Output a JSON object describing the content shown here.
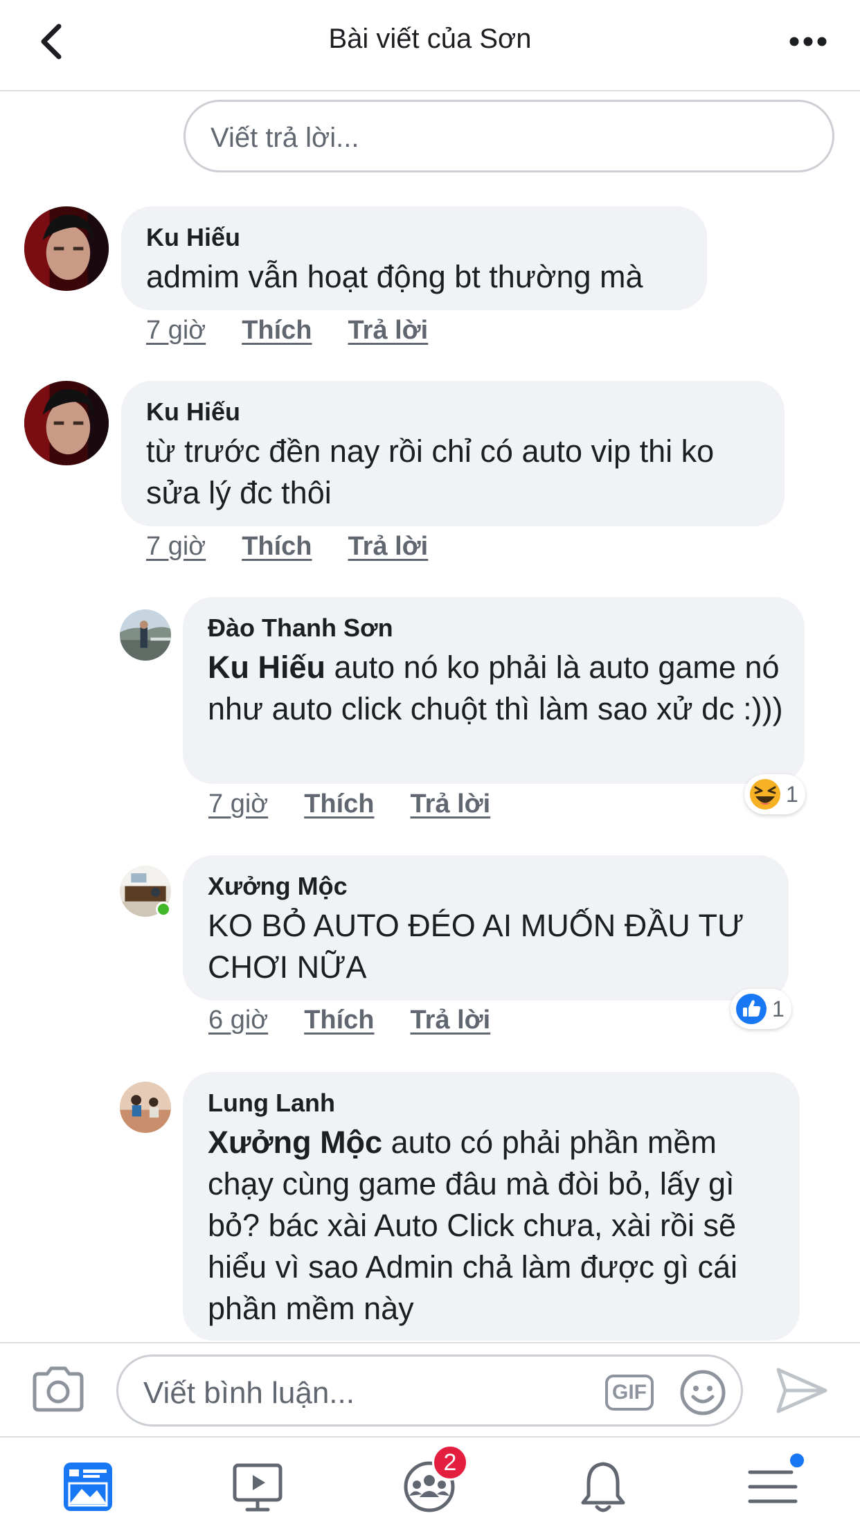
{
  "header": {
    "title": "Bài viết của Sơn"
  },
  "reply_box": {
    "placeholder": "Viết trả lời..."
  },
  "comments": [
    {
      "author": "Ku Hiếu",
      "text": "admim vẫn hoạt động bt thường mà",
      "time": "7 giờ",
      "like_label": "Thích",
      "reply_label": "Trả lời"
    },
    {
      "author": "Ku Hiếu",
      "text": "từ trước đền nay rồi chỉ có auto vip thi ko sửa lý đc thôi",
      "time": "7 giờ",
      "like_label": "Thích",
      "reply_label": "Trả lời"
    },
    {
      "author": "Đào Thanh Sơn",
      "mention": "Ku Hiếu",
      "text": " auto nó ko phải là auto game nó như auto click chuột thì làm sao xử dc :)))",
      "time": "7 giờ",
      "like_label": "Thích",
      "reply_label": "Trả lời",
      "reaction": {
        "icon": "haha-emoji-icon",
        "count": "1"
      }
    },
    {
      "author": "Xưởng Mộc",
      "text": "KO BỎ AUTO ĐÉO AI MUỐN ĐẦU TƯ CHƠI NỮA",
      "time": "6 giờ",
      "like_label": "Thích",
      "reply_label": "Trả lời",
      "online": true,
      "reaction": {
        "icon": "like-thumb-icon",
        "count": "1"
      }
    },
    {
      "author": "Lung Lanh",
      "mention": "Xưởng Mộc",
      "text": " auto có phải phần mềm chạy cùng game đâu mà đòi bỏ, lấy gì bỏ? bác xài Auto Click chưa, xài rồi sẽ hiểu vì sao Admin chả làm được gì cái phần mềm này"
    }
  ],
  "composer": {
    "placeholder": "Viết bình luận...",
    "gif_label": "GIF"
  },
  "bottom_nav": {
    "groups_badge": "2"
  },
  "colors": {
    "accent": "#1877f2",
    "bubble": "#f0f2f5",
    "badge": "#e41e3f",
    "online": "#42b72a"
  }
}
